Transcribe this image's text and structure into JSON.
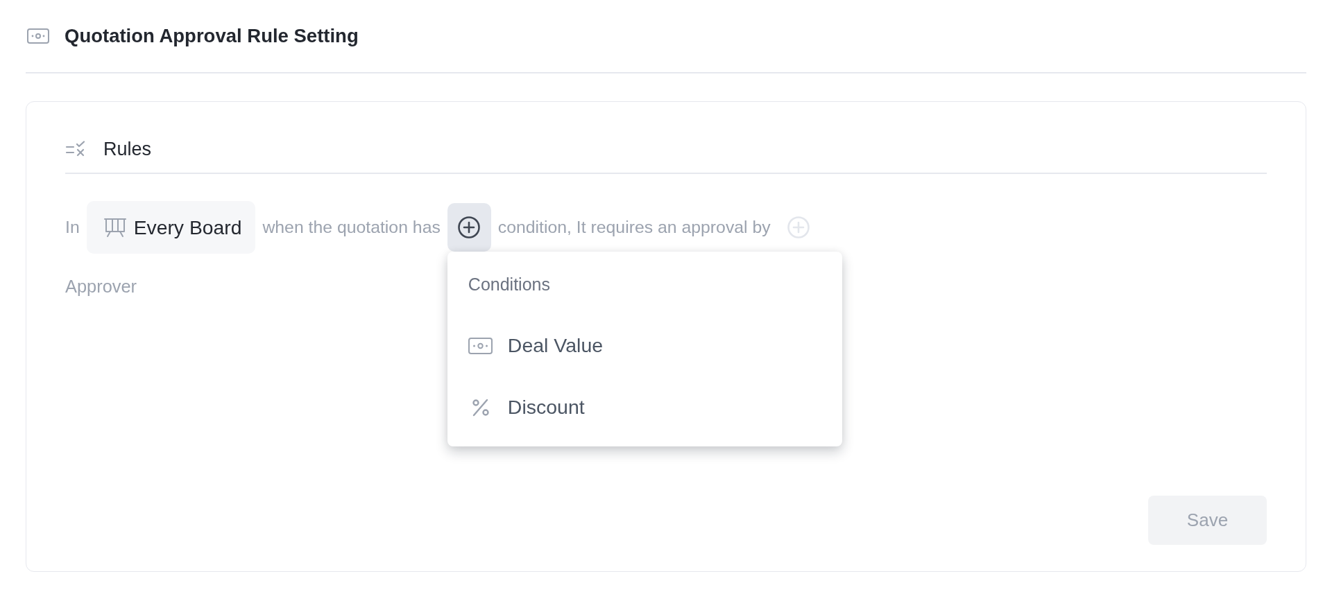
{
  "page": {
    "title": "Quotation Approval Rule Setting"
  },
  "rules": {
    "title": "Rules",
    "sentence": [
      {
        "kind": "text",
        "text": "In"
      },
      {
        "kind": "chip",
        "text": "Every Board"
      },
      {
        "kind": "text",
        "text": "when the quotation has"
      },
      {
        "kind": "add",
        "active": true,
        "disabled": false
      },
      {
        "kind": "text",
        "text": "condition, It requires an approval by"
      },
      {
        "kind": "add",
        "active": false,
        "disabled": true
      }
    ],
    "approver_label": "Approver"
  },
  "conditions_menu": {
    "open": true,
    "title": "Conditions",
    "items": [
      {
        "label": "Deal Value"
      },
      {
        "label": "Discount"
      }
    ]
  },
  "save_button": {
    "label": "Save",
    "disabled": true
  }
}
